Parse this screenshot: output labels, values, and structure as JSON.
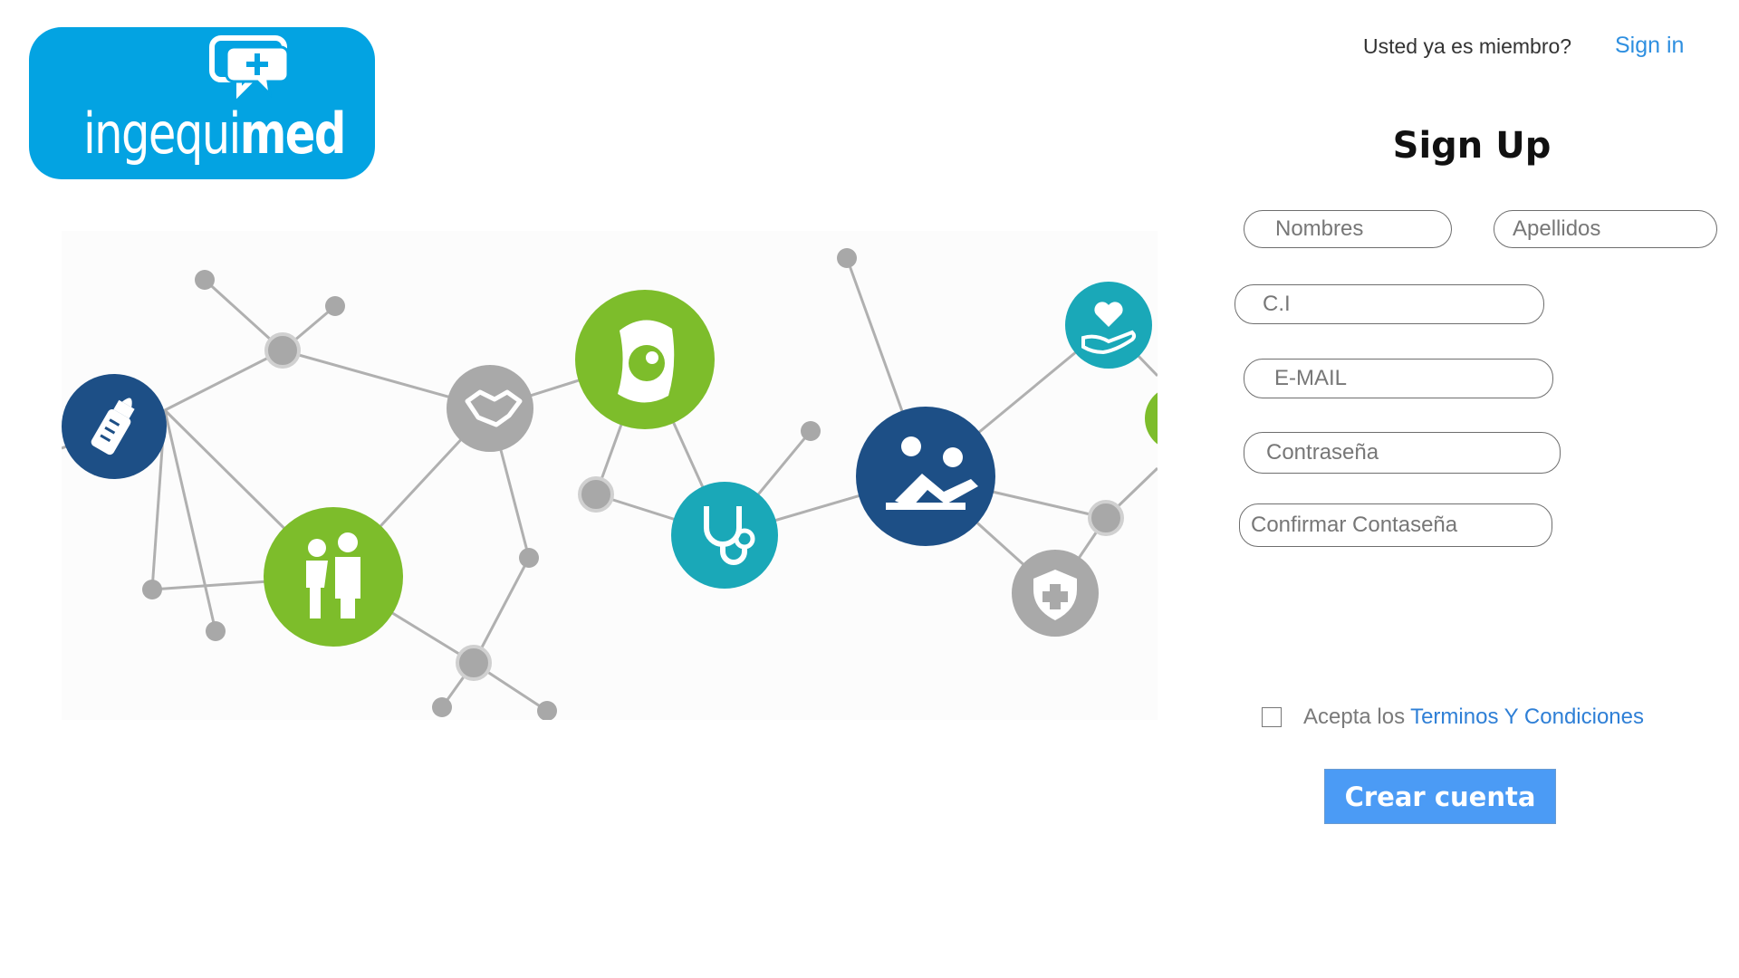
{
  "logo": {
    "text_light": "ingequi",
    "text_bold": "med",
    "brand_color": "#03a3e2"
  },
  "header": {
    "member_question": "Usted ya es miembro?",
    "signin_label": "Sign in"
  },
  "form": {
    "title": "Sign Up",
    "fields": {
      "nombres": {
        "placeholder": "Nombres",
        "value": ""
      },
      "apellidos": {
        "placeholder": "Apellidos",
        "value": ""
      },
      "ci": {
        "placeholder": "C.I",
        "value": ""
      },
      "email": {
        "placeholder": "E-MAIL",
        "value": ""
      },
      "password": {
        "placeholder": "Contraseña",
        "value": ""
      },
      "confirm_password": {
        "placeholder": "Confirmar Contaseña",
        "value": ""
      }
    },
    "terms": {
      "checked": false,
      "prefix": "Acepta los",
      "link": "Terminos Y Condiciones"
    },
    "submit_label": "Crear cuenta",
    "accent_color": "#4b9bf5",
    "link_color": "#2e8fe0"
  },
  "illustration": {
    "icons": [
      "baby-bottle-icon",
      "family-icon",
      "handshake-icon",
      "pregnancy-icon",
      "stethoscope-icon",
      "patient-care-icon",
      "heart-hand-icon",
      "shield-cross-icon"
    ],
    "colors": {
      "navy": "#1d4f86",
      "green": "#7dbd2b",
      "teal": "#1aa8b8",
      "gray": "#a9a9a9"
    }
  }
}
